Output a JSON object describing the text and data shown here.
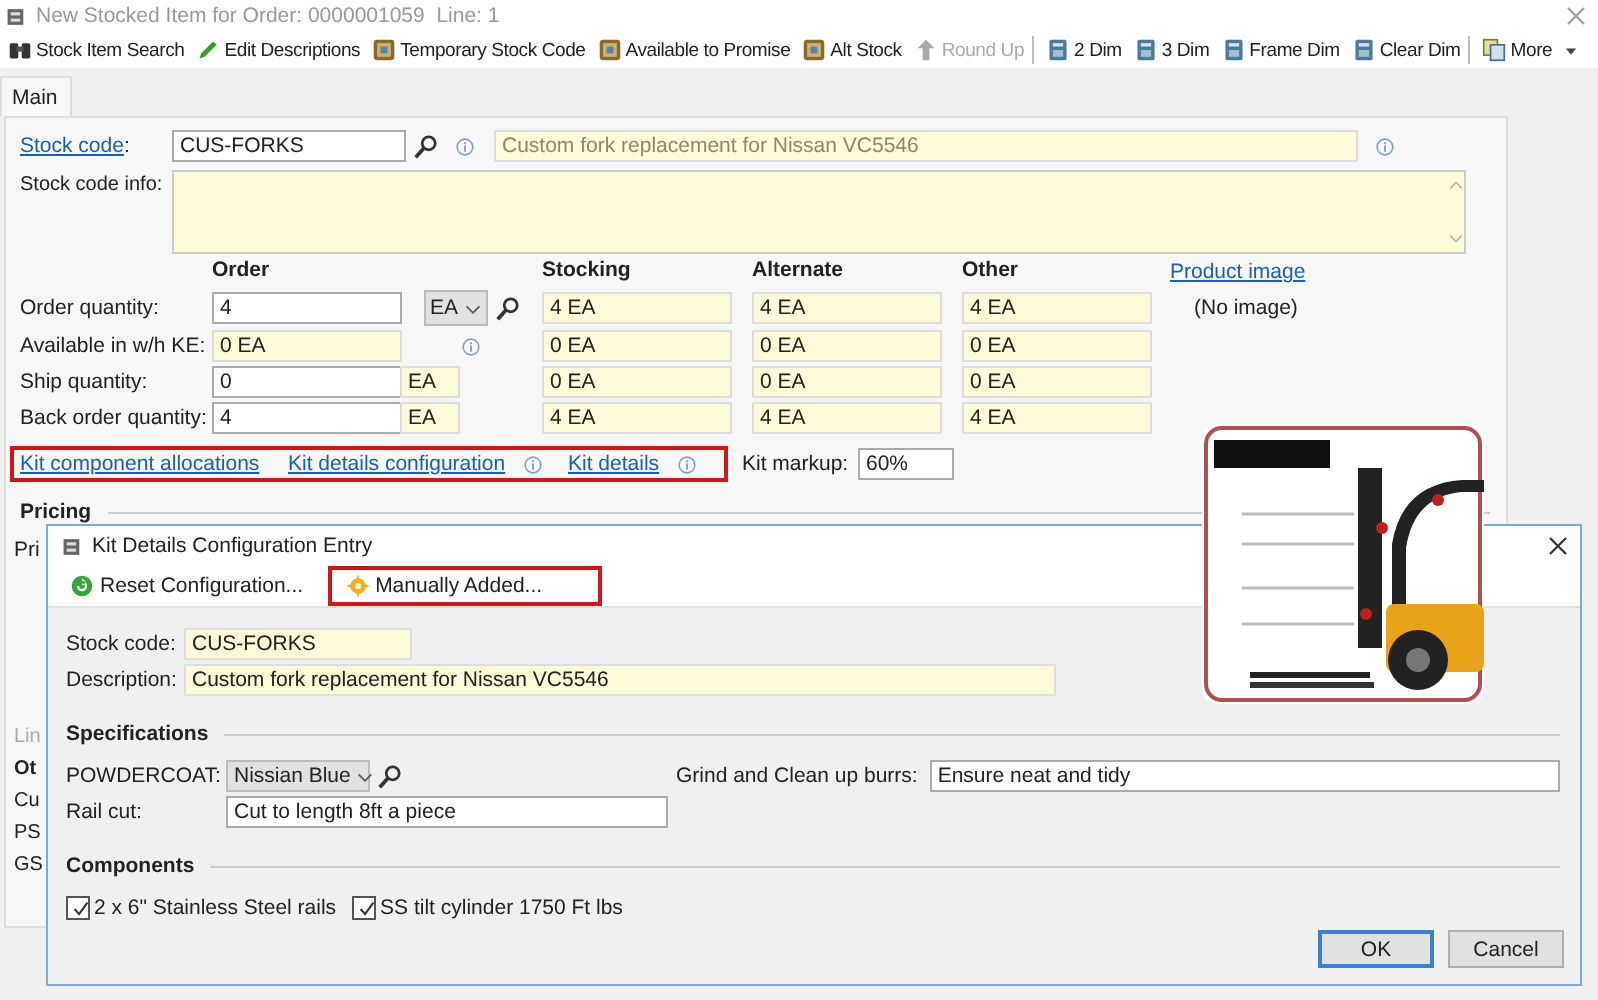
{
  "window": {
    "title": "New Stocked Item for Order: 0000001059  Line: 1"
  },
  "toolbar": [
    [
      {
        "label": "Stock Item Search",
        "kind": "binoculars",
        "disabled": false
      },
      {
        "label": "Edit Descriptions",
        "kind": "pencil",
        "disabled": false
      },
      {
        "label": "Temporary Stock Code",
        "kind": "package",
        "disabled": false
      },
      {
        "label": "Available to Promise",
        "kind": "package",
        "disabled": false
      },
      {
        "label": "Alt Stock",
        "kind": "package",
        "disabled": false
      },
      {
        "label": "Round Up",
        "kind": "arrow",
        "disabled": true
      }
    ],
    [
      {
        "label": "2 Dim",
        "kind": "calculator",
        "disabled": false
      },
      {
        "label": "3 Dim",
        "kind": "calculator",
        "disabled": false
      },
      {
        "label": "Frame Dim",
        "kind": "calculator",
        "disabled": false
      },
      {
        "label": "Clear Dim",
        "kind": "calculator",
        "disabled": false
      }
    ],
    [
      {
        "label": "More",
        "kind": "documents",
        "disabled": false,
        "menu": true
      }
    ]
  ],
  "tabs": [
    {
      "label": "Main",
      "selected": true
    }
  ],
  "stock_code": {
    "label": "Stock code",
    "label_suffix": ":",
    "value": "CUS-FORKS",
    "description": "Custom fork replacement for Nissan VC5546"
  },
  "stock_code_info": {
    "label": "Stock code info:"
  },
  "quantities": {
    "columns": [
      "Order",
      "Stocking",
      "Alternate",
      "Other"
    ],
    "rows": [
      {
        "label": "Order quantity:",
        "order": "4",
        "kind": "dropdown",
        "unit": "EA",
        "stocking": "4 EA",
        "alternate": "4 EA",
        "other": "4 EA"
      },
      {
        "label": "Available in w/h KE:",
        "order": "0 EA",
        "kind": "info",
        "stocking": "0 EA",
        "alternate": "0 EA",
        "other": "0 EA"
      },
      {
        "label": "Ship quantity:",
        "order": "0",
        "kind": "text",
        "unit": "EA",
        "stocking": "0 EA",
        "alternate": "0 EA",
        "other": "0 EA"
      },
      {
        "label": "Back order quantity:",
        "order": "4",
        "kind": "text",
        "unit": "EA",
        "stocking": "4 EA",
        "alternate": "4 EA",
        "other": "4 EA"
      }
    ]
  },
  "product_image": {
    "link": "Product image",
    "text": "(No image)"
  },
  "kit_links": {
    "highlighted": true,
    "items": [
      {
        "label": "Kit component allocations",
        "info": false
      },
      {
        "label": "Kit details configuration",
        "info": true
      },
      {
        "label": "Kit details",
        "info": true
      }
    ]
  },
  "kit_markup": {
    "label": "Kit markup:",
    "value": "60%"
  },
  "pricing": {
    "title": "Pricing",
    "label": "Pri"
  },
  "partial_labels": [
    {
      "text": "Lin",
      "kind": "disabled"
    },
    {
      "text": "Ot",
      "kind": "heading"
    },
    {
      "text": "Cu",
      "kind": "label"
    },
    {
      "text": "PS",
      "kind": "label"
    },
    {
      "text": "GS",
      "kind": "label"
    }
  ],
  "dialog": {
    "title": "Kit Details Configuration Entry",
    "toolbar": [
      {
        "label": "Reset Configuration...",
        "kind": "refresh",
        "highlighted": false
      },
      {
        "label": "Manually Added...",
        "kind": "gear",
        "highlighted": true
      }
    ],
    "stock_code": {
      "label": "Stock code:",
      "value": "CUS-FORKS"
    },
    "description": {
      "label": "Description:",
      "value": "Custom fork replacement for Nissan VC5546"
    },
    "specifications": {
      "title": "Specifications",
      "powdercoat": {
        "label": "POWDERCOAT:",
        "value": "Nissian Blue"
      },
      "grind": {
        "label": "Grind and Clean up burrs:",
        "value": "Ensure neat and tidy"
      },
      "rail_cut": {
        "label": "Rail cut:",
        "value": "Cut to length 8ft a piece"
      }
    },
    "components": {
      "title": "Components",
      "items": [
        {
          "label": "2 x 6\" Stainless Steel rails",
          "checked": true
        },
        {
          "label": "SS tilt cylinder 1750 Ft lbs",
          "checked": true
        }
      ]
    },
    "buttons": [
      {
        "label": "OK",
        "default": true
      },
      {
        "label": "Cancel",
        "default": false
      }
    ]
  },
  "picture": {
    "kind": "picture"
  }
}
